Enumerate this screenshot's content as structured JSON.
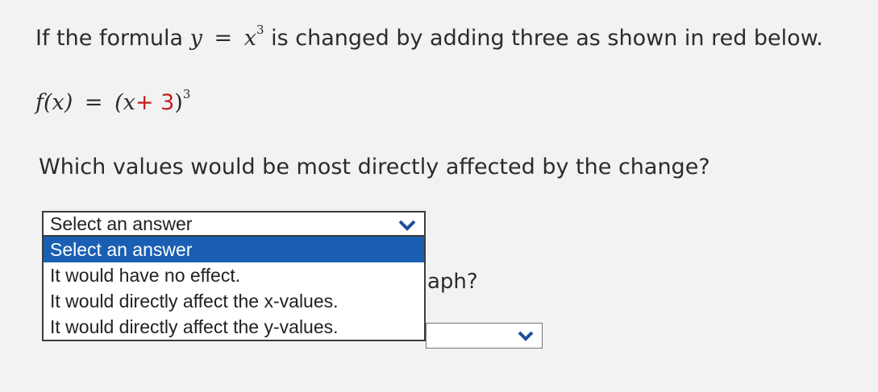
{
  "question": {
    "prompt_before": "If the formula",
    "prompt_math_y": "y",
    "prompt_equals": "=",
    "prompt_math_x": "x",
    "prompt_exponent": "3",
    "prompt_after": "is changed by adding three as shown in red below.",
    "formula_lhs": "f(x)",
    "formula_equals": "=",
    "formula_open": "(x",
    "formula_plus3": "+ 3",
    "formula_close": ")",
    "formula_exponent": "3",
    "text": "Which values would be most directly affected by the change?"
  },
  "dropdown": {
    "selected_label": "Select an answer",
    "options": [
      "Select an answer",
      "It would have no effect.",
      "It would directly affect the x-values.",
      "It would directly affect the y-values."
    ],
    "highlighted_index": 0
  },
  "next_question_partial": "aph?",
  "accent_color": "#1a5fb4",
  "highlight_text_color": "#c41e1e",
  "icons": {
    "dropdown_arrow": "chevron-down-icon"
  }
}
